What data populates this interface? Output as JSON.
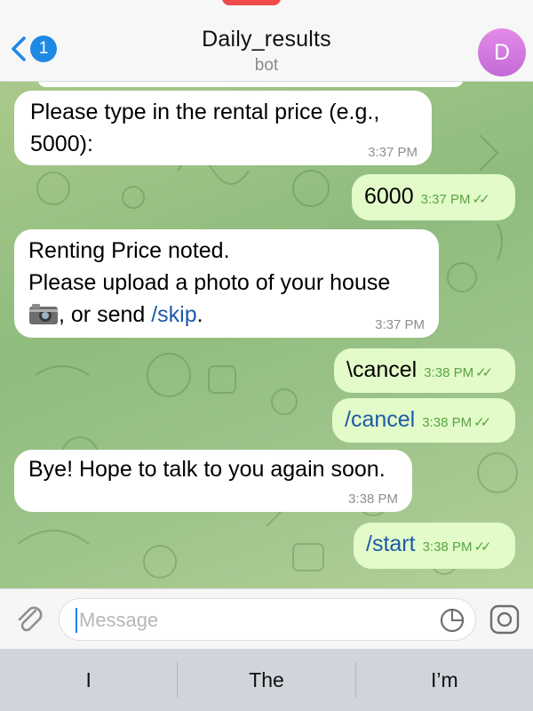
{
  "header": {
    "back_count": "1",
    "title": "Daily_results",
    "subtitle": "bot",
    "avatar_initial": "D"
  },
  "messages": [
    {
      "direction": "in",
      "lines": [
        "Please type in the rental price (e.g.,",
        "5000):"
      ],
      "time": "3:37 PM"
    },
    {
      "direction": "out",
      "text": "6000",
      "time": "3:37 PM"
    },
    {
      "direction": "in",
      "lines": [
        "Renting Price noted.",
        "Please upload a photo of your house"
      ],
      "line3_suffix": ", or send ",
      "link": "/skip",
      "line3_end": ".",
      "icon": "camera-icon",
      "time": "3:37 PM"
    },
    {
      "direction": "out",
      "text": "\\cancel",
      "time": "3:38 PM"
    },
    {
      "direction": "out",
      "text": "/cancel",
      "time": "3:38 PM",
      "is_link": true
    },
    {
      "direction": "in",
      "lines": [
        "Bye! Hope to talk to you again soon."
      ],
      "time": "3:38 PM"
    },
    {
      "direction": "out",
      "text": "/start",
      "time": "3:38 PM",
      "is_link": true
    }
  ],
  "input": {
    "placeholder": "Message"
  },
  "suggestions": [
    "I",
    "The",
    "I’m"
  ],
  "colors": {
    "accent": "#1e88e5",
    "outgoing_bubble": "#e2fbc9",
    "incoming_bubble": "#ffffff",
    "link": "#1d5aa8",
    "avatar": "#d17ae0"
  }
}
